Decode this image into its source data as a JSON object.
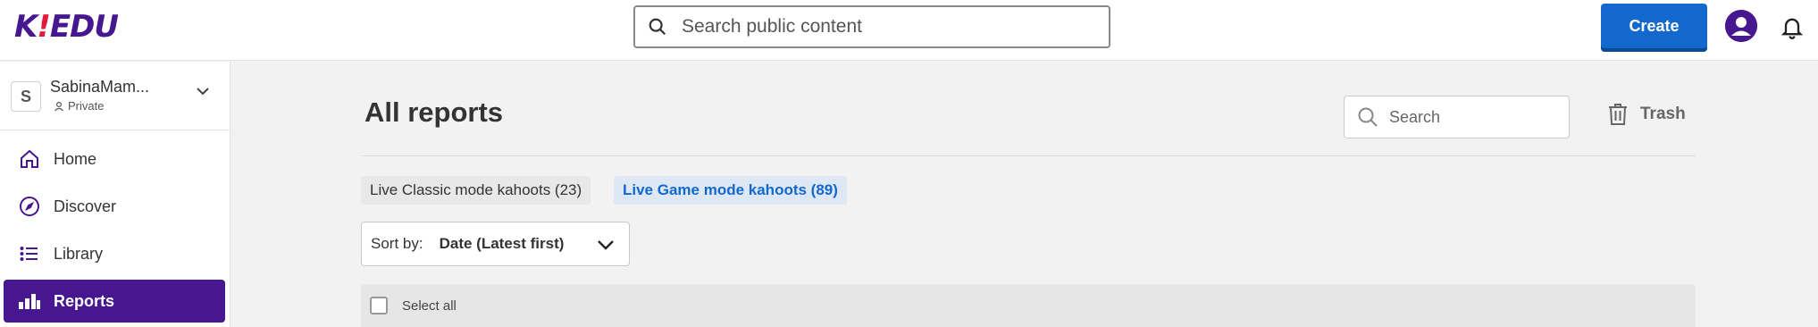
{
  "header": {
    "logo_main": "K",
    "logo_exclaim": "!",
    "logo_edu": "EDU",
    "search_placeholder": "Search public content",
    "create_label": "Create"
  },
  "sidebar": {
    "account": {
      "initial": "S",
      "name": "SabinaMam...",
      "visibility": "Private"
    },
    "items": [
      {
        "label": "Home",
        "icon": "home-icon"
      },
      {
        "label": "Discover",
        "icon": "compass-icon"
      },
      {
        "label": "Library",
        "icon": "list-icon"
      },
      {
        "label": "Reports",
        "icon": "bar-chart-icon",
        "active": true
      }
    ]
  },
  "main": {
    "title": "All reports",
    "search_placeholder": "Search",
    "trash_label": "Trash",
    "tabs": [
      {
        "label": "Live Classic mode kahoots (23)"
      },
      {
        "label": "Live Game mode kahoots (89)",
        "active": true
      }
    ],
    "sort": {
      "label": "Sort by:",
      "value": "Date (Latest first)"
    },
    "select_all_label": "Select all"
  },
  "colors": {
    "brand_purple": "#46178f",
    "primary_blue": "#1368ce",
    "logo_exclaim_red": "#e21b3c"
  }
}
